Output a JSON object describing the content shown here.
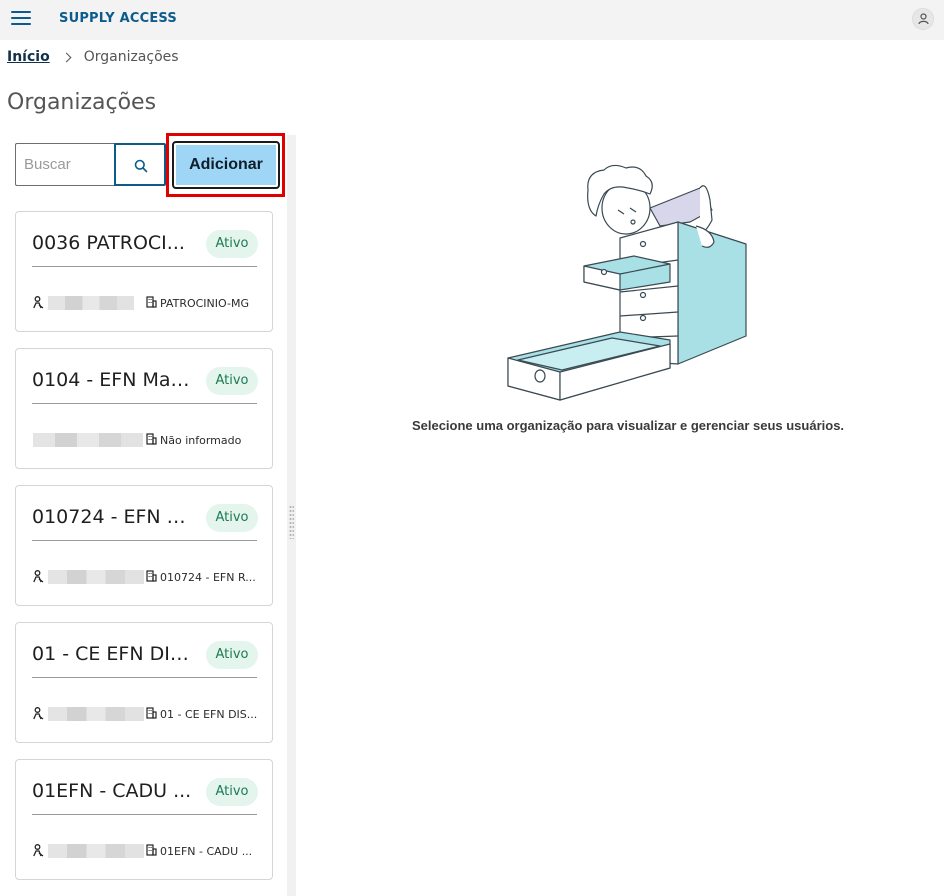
{
  "header": {
    "app_title": "SUPPLY ACCESS"
  },
  "breadcrumb": {
    "home": "Início",
    "current": "Organizações"
  },
  "page": {
    "title": "Organizações"
  },
  "toolbar": {
    "search_placeholder": "Buscar",
    "add_label": "Adicionar"
  },
  "organizations": [
    {
      "title": "0036 PATROCI...",
      "status": "Ativo",
      "location": "PATROCINIO-MG"
    },
    {
      "title": "0104 - EFN Man...",
      "status": "Ativo",
      "location": "Não informado"
    },
    {
      "title": "010724 - EFN R...",
      "status": "Ativo",
      "location": "010724 - EFN R..."
    },
    {
      "title": "01 - CE EFN DIS...",
      "status": "Ativo",
      "location": "01 - CE EFN DIS..."
    },
    {
      "title": "01EFN - CADU ...",
      "status": "Ativo",
      "location": "01EFN - CADU ..."
    }
  ],
  "empty_state": {
    "message": "Selecione uma organização para visualizar e gerenciar seus usuários."
  },
  "colors": {
    "brand": "#0c5b8a",
    "add_button": "#9fd6f6",
    "badge_bg": "#e3f5ec",
    "badge_text": "#1e7a52",
    "highlight": "#e00000",
    "illustration_fill": "#a8e0e6"
  },
  "icons": {
    "menu": "hamburger-icon",
    "user": "user-icon",
    "search": "search-icon",
    "person": "person-icon",
    "building": "building-icon"
  }
}
